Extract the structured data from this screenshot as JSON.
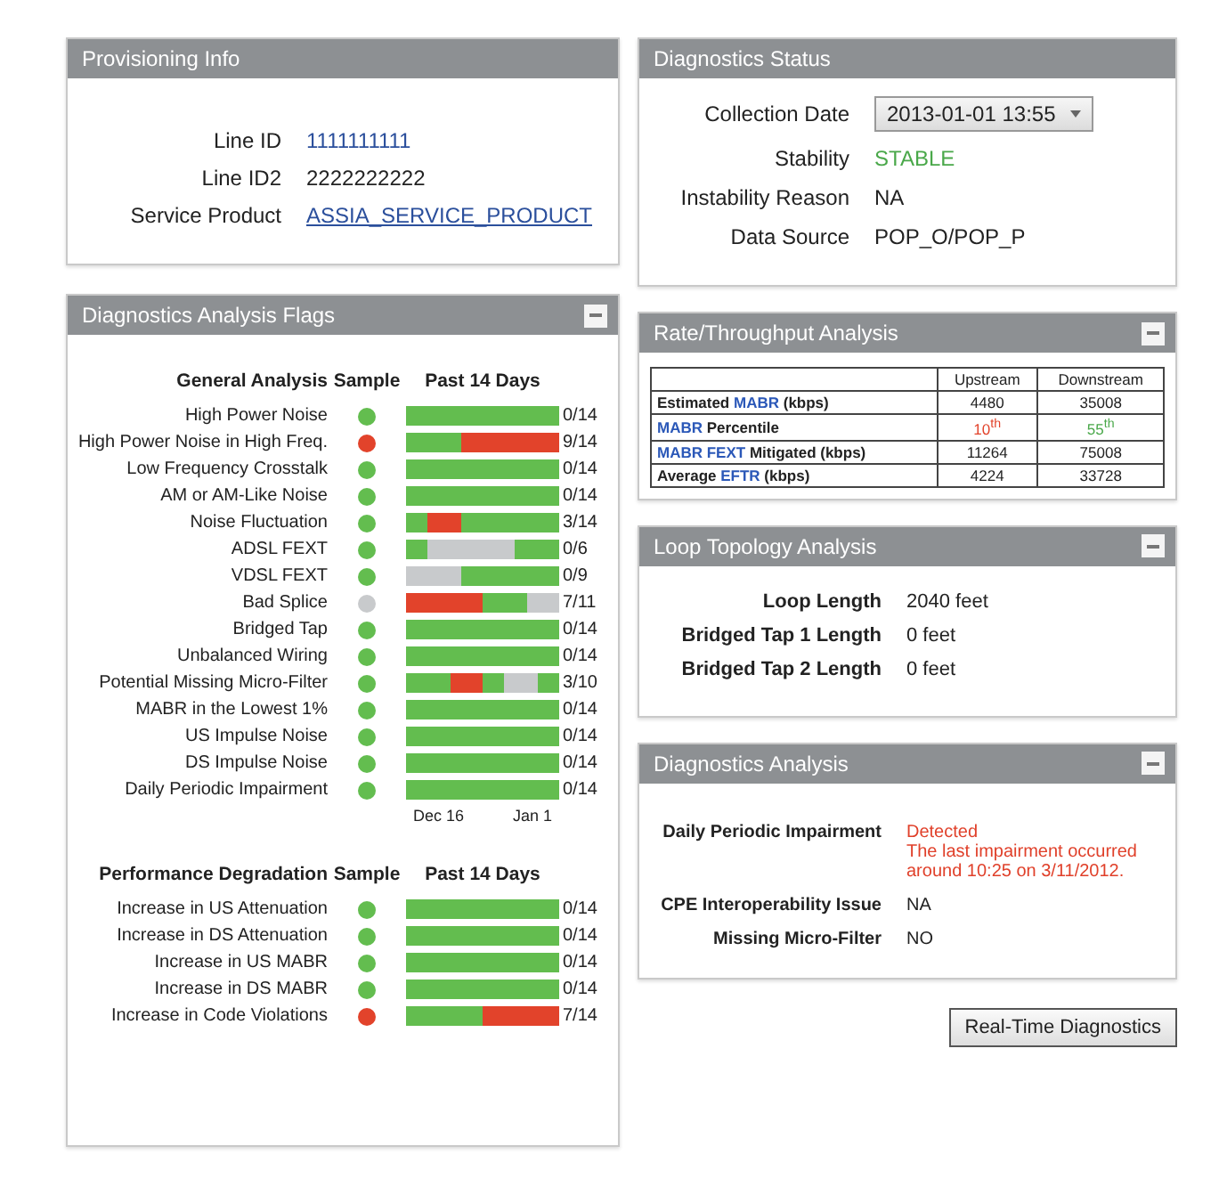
{
  "provisioning": {
    "title": "Provisioning Info",
    "fields": [
      {
        "label": "Line ID",
        "value": "1111111111",
        "kind": "id"
      },
      {
        "label": "Line ID2",
        "value": "2222222222",
        "kind": "text"
      },
      {
        "label": "Service Product",
        "value": "ASSIA_SERVICE_PRODUCT",
        "kind": "link"
      }
    ]
  },
  "diagnostics_status": {
    "title": "Diagnostics Status",
    "fields": [
      {
        "label": "Collection Date",
        "value": "2013-01-01 13:55",
        "kind": "dropdown"
      },
      {
        "label": "Stability",
        "value": "STABLE",
        "kind": "good"
      },
      {
        "label": "Instability Reason",
        "value": "NA",
        "kind": "text"
      },
      {
        "label": "Data Source",
        "value": "POP_O/POP_P",
        "kind": "text"
      }
    ]
  },
  "analysis_flags": {
    "title": "Diagnostics Analysis Flags",
    "collapsible": true,
    "sections": [
      {
        "heading": "General Analysis",
        "sample_heading": "Sample",
        "period_heading": "Past 14 Days",
        "axis_labels": [
          "Dec 16",
          "Jan 1"
        ],
        "rows": [
          {
            "name": "High Power Noise",
            "color": "#63bd4f",
            "days": [
              {
                "color": "#63bd4f"
              },
              {
                "color": "#63bd4f"
              },
              {
                "color": "#63bd4f"
              },
              {
                "color": "#63bd4f"
              },
              {
                "color": "#63bd4f"
              },
              {
                "color": "#63bd4f"
              },
              {
                "color": "#63bd4f"
              },
              {
                "color": "#63bd4f"
              },
              {
                "color": "#63bd4f"
              },
              {
                "color": "#63bd4f"
              },
              {
                "color": "#63bd4f"
              },
              {
                "color": "#63bd4f"
              },
              {
                "color": "#63bd4f"
              },
              {
                "color": "#63bd4f"
              }
            ],
            "count": "0/14"
          },
          {
            "name": "High Power Noise in High Freq.",
            "color": "#e2432b",
            "days": [
              {
                "color": "#63bd4f"
              },
              {
                "color": "#63bd4f"
              },
              {
                "color": "#63bd4f"
              },
              {
                "color": "#63bd4f"
              },
              {
                "color": "#63bd4f"
              },
              {
                "color": "#e2432b"
              },
              {
                "color": "#e2432b"
              },
              {
                "color": "#e2432b"
              },
              {
                "color": "#e2432b"
              },
              {
                "color": "#e2432b"
              },
              {
                "color": "#e2432b"
              },
              {
                "color": "#e2432b"
              },
              {
                "color": "#e2432b"
              },
              {
                "color": "#e2432b"
              }
            ],
            "count": "9/14"
          },
          {
            "name": "Low Frequency Crosstalk",
            "color": "#63bd4f",
            "days": [
              {
                "color": "#63bd4f"
              },
              {
                "color": "#63bd4f"
              },
              {
                "color": "#63bd4f"
              },
              {
                "color": "#63bd4f"
              },
              {
                "color": "#63bd4f"
              },
              {
                "color": "#63bd4f"
              },
              {
                "color": "#63bd4f"
              },
              {
                "color": "#63bd4f"
              },
              {
                "color": "#63bd4f"
              },
              {
                "color": "#63bd4f"
              },
              {
                "color": "#63bd4f"
              },
              {
                "color": "#63bd4f"
              },
              {
                "color": "#63bd4f"
              },
              {
                "color": "#63bd4f"
              }
            ],
            "count": "0/14"
          },
          {
            "name": "AM or AM-Like Noise",
            "color": "#63bd4f",
            "days": [
              {
                "color": "#63bd4f"
              },
              {
                "color": "#63bd4f"
              },
              {
                "color": "#63bd4f"
              },
              {
                "color": "#63bd4f"
              },
              {
                "color": "#63bd4f"
              },
              {
                "color": "#63bd4f"
              },
              {
                "color": "#63bd4f"
              },
              {
                "color": "#63bd4f"
              },
              {
                "color": "#63bd4f"
              },
              {
                "color": "#63bd4f"
              },
              {
                "color": "#63bd4f"
              },
              {
                "color": "#63bd4f"
              },
              {
                "color": "#63bd4f"
              },
              {
                "color": "#63bd4f"
              }
            ],
            "count": "0/14"
          },
          {
            "name": "Noise Fluctuation",
            "color": "#63bd4f",
            "days": [
              {
                "color": "#63bd4f"
              },
              {
                "color": "#63bd4f"
              },
              {
                "color": "#e2432b"
              },
              {
                "color": "#e2432b"
              },
              {
                "color": "#e2432b"
              },
              {
                "color": "#63bd4f"
              },
              {
                "color": "#63bd4f"
              },
              {
                "color": "#63bd4f"
              },
              {
                "color": "#63bd4f"
              },
              {
                "color": "#63bd4f"
              },
              {
                "color": "#63bd4f"
              },
              {
                "color": "#63bd4f"
              },
              {
                "color": "#63bd4f"
              },
              {
                "color": "#63bd4f"
              }
            ],
            "count": "3/14"
          },
          {
            "name": "ADSL FEXT",
            "color": "#63bd4f",
            "days": [
              {
                "color": "#63bd4f"
              },
              {
                "color": "#63bd4f"
              },
              {
                "color": "#c8cacc"
              },
              {
                "color": "#c8cacc"
              },
              {
                "color": "#c8cacc"
              },
              {
                "color": "#c8cacc"
              },
              {
                "color": "#c8cacc"
              },
              {
                "color": "#c8cacc"
              },
              {
                "color": "#c8cacc"
              },
              {
                "color": "#c8cacc"
              },
              {
                "color": "#63bd4f"
              },
              {
                "color": "#63bd4f"
              },
              {
                "color": "#63bd4f"
              },
              {
                "color": "#63bd4f"
              }
            ],
            "count": "0/6"
          },
          {
            "name": "VDSL FEXT",
            "color": "#63bd4f",
            "days": [
              {
                "color": "#c8cacc"
              },
              {
                "color": "#c8cacc"
              },
              {
                "color": "#c8cacc"
              },
              {
                "color": "#c8cacc"
              },
              {
                "color": "#c8cacc"
              },
              {
                "color": "#63bd4f"
              },
              {
                "color": "#63bd4f"
              },
              {
                "color": "#63bd4f"
              },
              {
                "color": "#63bd4f"
              },
              {
                "color": "#63bd4f"
              },
              {
                "color": "#63bd4f"
              },
              {
                "color": "#63bd4f"
              },
              {
                "color": "#63bd4f"
              },
              {
                "color": "#63bd4f"
              }
            ],
            "count": "0/9"
          },
          {
            "name": "Bad Splice",
            "color": "#c8cacc",
            "days": [
              {
                "color": "#e2432b"
              },
              {
                "color": "#e2432b"
              },
              {
                "color": "#e2432b"
              },
              {
                "color": "#e2432b"
              },
              {
                "color": "#e2432b"
              },
              {
                "color": "#e2432b"
              },
              {
                "color": "#e2432b"
              },
              {
                "color": "#63bd4f"
              },
              {
                "color": "#63bd4f"
              },
              {
                "color": "#63bd4f"
              },
              {
                "color": "#63bd4f"
              },
              {
                "color": "#c8cacc"
              },
              {
                "color": "#c8cacc"
              },
              {
                "color": "#c8cacc"
              }
            ],
            "count": "7/11"
          },
          {
            "name": "Bridged Tap",
            "color": "#63bd4f",
            "days": [
              {
                "color": "#63bd4f"
              },
              {
                "color": "#63bd4f"
              },
              {
                "color": "#63bd4f"
              },
              {
                "color": "#63bd4f"
              },
              {
                "color": "#63bd4f"
              },
              {
                "color": "#63bd4f"
              },
              {
                "color": "#63bd4f"
              },
              {
                "color": "#63bd4f"
              },
              {
                "color": "#63bd4f"
              },
              {
                "color": "#63bd4f"
              },
              {
                "color": "#63bd4f"
              },
              {
                "color": "#63bd4f"
              },
              {
                "color": "#63bd4f"
              },
              {
                "color": "#63bd4f"
              }
            ],
            "count": "0/14"
          },
          {
            "name": "Unbalanced Wiring",
            "color": "#63bd4f",
            "days": [
              {
                "color": "#63bd4f"
              },
              {
                "color": "#63bd4f"
              },
              {
                "color": "#63bd4f"
              },
              {
                "color": "#63bd4f"
              },
              {
                "color": "#63bd4f"
              },
              {
                "color": "#63bd4f"
              },
              {
                "color": "#63bd4f"
              },
              {
                "color": "#63bd4f"
              },
              {
                "color": "#63bd4f"
              },
              {
                "color": "#63bd4f"
              },
              {
                "color": "#63bd4f"
              },
              {
                "color": "#63bd4f"
              },
              {
                "color": "#63bd4f"
              },
              {
                "color": "#63bd4f"
              }
            ],
            "count": "0/14"
          },
          {
            "name": "Potential Missing Micro-Filter",
            "color": "#63bd4f",
            "days": [
              {
                "color": "#63bd4f"
              },
              {
                "color": "#63bd4f"
              },
              {
                "color": "#63bd4f"
              },
              {
                "color": "#63bd4f"
              },
              {
                "color": "#e2432b"
              },
              {
                "color": "#e2432b"
              },
              {
                "color": "#e2432b"
              },
              {
                "color": "#63bd4f"
              },
              {
                "color": "#63bd4f"
              },
              {
                "color": "#c8cacc"
              },
              {
                "color": "#c8cacc"
              },
              {
                "color": "#c8cacc"
              },
              {
                "color": "#63bd4f"
              },
              {
                "color": "#63bd4f"
              }
            ],
            "count": "3/10"
          },
          {
            "name": "MABR in the Lowest 1%",
            "color": "#63bd4f",
            "days": [
              {
                "color": "#63bd4f"
              },
              {
                "color": "#63bd4f"
              },
              {
                "color": "#63bd4f"
              },
              {
                "color": "#63bd4f"
              },
              {
                "color": "#63bd4f"
              },
              {
                "color": "#63bd4f"
              },
              {
                "color": "#63bd4f"
              },
              {
                "color": "#63bd4f"
              },
              {
                "color": "#63bd4f"
              },
              {
                "color": "#63bd4f"
              },
              {
                "color": "#63bd4f"
              },
              {
                "color": "#63bd4f"
              },
              {
                "color": "#63bd4f"
              },
              {
                "color": "#63bd4f"
              }
            ],
            "count": "0/14"
          },
          {
            "name": "US Impulse Noise",
            "color": "#63bd4f",
            "days": [
              {
                "color": "#63bd4f"
              },
              {
                "color": "#63bd4f"
              },
              {
                "color": "#63bd4f"
              },
              {
                "color": "#63bd4f"
              },
              {
                "color": "#63bd4f"
              },
              {
                "color": "#63bd4f"
              },
              {
                "color": "#63bd4f"
              },
              {
                "color": "#63bd4f"
              },
              {
                "color": "#63bd4f"
              },
              {
                "color": "#63bd4f"
              },
              {
                "color": "#63bd4f"
              },
              {
                "color": "#63bd4f"
              },
              {
                "color": "#63bd4f"
              },
              {
                "color": "#63bd4f"
              }
            ],
            "count": "0/14"
          },
          {
            "name": "DS Impulse Noise",
            "color": "#63bd4f",
            "days": [
              {
                "color": "#63bd4f"
              },
              {
                "color": "#63bd4f"
              },
              {
                "color": "#63bd4f"
              },
              {
                "color": "#63bd4f"
              },
              {
                "color": "#63bd4f"
              },
              {
                "color": "#63bd4f"
              },
              {
                "color": "#63bd4f"
              },
              {
                "color": "#63bd4f"
              },
              {
                "color": "#63bd4f"
              },
              {
                "color": "#63bd4f"
              },
              {
                "color": "#63bd4f"
              },
              {
                "color": "#63bd4f"
              },
              {
                "color": "#63bd4f"
              },
              {
                "color": "#63bd4f"
              }
            ],
            "count": "0/14"
          },
          {
            "name": "Daily Periodic Impairment",
            "color": "#63bd4f",
            "days": [
              {
                "color": "#63bd4f"
              },
              {
                "color": "#63bd4f"
              },
              {
                "color": "#63bd4f"
              },
              {
                "color": "#63bd4f"
              },
              {
                "color": "#63bd4f"
              },
              {
                "color": "#63bd4f"
              },
              {
                "color": "#63bd4f"
              },
              {
                "color": "#63bd4f"
              },
              {
                "color": "#63bd4f"
              },
              {
                "color": "#63bd4f"
              },
              {
                "color": "#63bd4f"
              },
              {
                "color": "#63bd4f"
              },
              {
                "color": "#63bd4f"
              },
              {
                "color": "#63bd4f"
              }
            ],
            "count": "0/14"
          }
        ]
      },
      {
        "heading": "Performance Degradation",
        "sample_heading": "Sample",
        "period_heading": "Past 14 Days",
        "rows": [
          {
            "name": "Increase in US Attenuation",
            "color": "#63bd4f",
            "days": [
              {
                "color": "#63bd4f"
              },
              {
                "color": "#63bd4f"
              },
              {
                "color": "#63bd4f"
              },
              {
                "color": "#63bd4f"
              },
              {
                "color": "#63bd4f"
              },
              {
                "color": "#63bd4f"
              },
              {
                "color": "#63bd4f"
              },
              {
                "color": "#63bd4f"
              },
              {
                "color": "#63bd4f"
              },
              {
                "color": "#63bd4f"
              },
              {
                "color": "#63bd4f"
              },
              {
                "color": "#63bd4f"
              },
              {
                "color": "#63bd4f"
              },
              {
                "color": "#63bd4f"
              }
            ],
            "count": "0/14"
          },
          {
            "name": "Increase in DS Attenuation",
            "color": "#63bd4f",
            "days": [
              {
                "color": "#63bd4f"
              },
              {
                "color": "#63bd4f"
              },
              {
                "color": "#63bd4f"
              },
              {
                "color": "#63bd4f"
              },
              {
                "color": "#63bd4f"
              },
              {
                "color": "#63bd4f"
              },
              {
                "color": "#63bd4f"
              },
              {
                "color": "#63bd4f"
              },
              {
                "color": "#63bd4f"
              },
              {
                "color": "#63bd4f"
              },
              {
                "color": "#63bd4f"
              },
              {
                "color": "#63bd4f"
              },
              {
                "color": "#63bd4f"
              },
              {
                "color": "#63bd4f"
              }
            ],
            "count": "0/14"
          },
          {
            "name": "Increase in US MABR",
            "color": "#63bd4f",
            "days": [
              {
                "color": "#63bd4f"
              },
              {
                "color": "#63bd4f"
              },
              {
                "color": "#63bd4f"
              },
              {
                "color": "#63bd4f"
              },
              {
                "color": "#63bd4f"
              },
              {
                "color": "#63bd4f"
              },
              {
                "color": "#63bd4f"
              },
              {
                "color": "#63bd4f"
              },
              {
                "color": "#63bd4f"
              },
              {
                "color": "#63bd4f"
              },
              {
                "color": "#63bd4f"
              },
              {
                "color": "#63bd4f"
              },
              {
                "color": "#63bd4f"
              },
              {
                "color": "#63bd4f"
              }
            ],
            "count": "0/14"
          },
          {
            "name": "Increase in DS MABR",
            "color": "#63bd4f",
            "days": [
              {
                "color": "#63bd4f"
              },
              {
                "color": "#63bd4f"
              },
              {
                "color": "#63bd4f"
              },
              {
                "color": "#63bd4f"
              },
              {
                "color": "#63bd4f"
              },
              {
                "color": "#63bd4f"
              },
              {
                "color": "#63bd4f"
              },
              {
                "color": "#63bd4f"
              },
              {
                "color": "#63bd4f"
              },
              {
                "color": "#63bd4f"
              },
              {
                "color": "#63bd4f"
              },
              {
                "color": "#63bd4f"
              },
              {
                "color": "#63bd4f"
              },
              {
                "color": "#63bd4f"
              }
            ],
            "count": "0/14"
          },
          {
            "name": "Increase in Code Violations",
            "color": "#e2432b",
            "days": [
              {
                "color": "#63bd4f"
              },
              {
                "color": "#63bd4f"
              },
              {
                "color": "#63bd4f"
              },
              {
                "color": "#63bd4f"
              },
              {
                "color": "#63bd4f"
              },
              {
                "color": "#63bd4f"
              },
              {
                "color": "#63bd4f"
              },
              {
                "color": "#e2432b"
              },
              {
                "color": "#e2432b"
              },
              {
                "color": "#e2432b"
              },
              {
                "color": "#e2432b"
              },
              {
                "color": "#e2432b"
              },
              {
                "color": "#e2432b"
              },
              {
                "color": "#e2432b"
              }
            ],
            "count": "7/14"
          }
        ]
      }
    ]
  },
  "rate_throughput": {
    "title": "Rate/Throughput Analysis",
    "collapsible": true,
    "columns": [
      "Upstream",
      "Downstream"
    ],
    "rows": [
      {
        "label": [
          {
            "text": "Estimated ",
            "link": false
          },
          {
            "text": "MABR",
            "link": true
          },
          {
            "text": " (kbps)",
            "link": false
          }
        ],
        "cells": [
          {
            "value": "4480"
          },
          {
            "value": "35008"
          }
        ]
      },
      {
        "label": [
          {
            "text": "MABR",
            "link": true
          },
          {
            "text": " Percentile",
            "link": false
          }
        ],
        "cells": [
          {
            "value": "10$^{th}$",
            "color": "#e2432b"
          },
          {
            "value": "55$^{th}$",
            "color": "#4aa84a"
          }
        ]
      },
      {
        "label": [
          {
            "text": "MABR FEXT",
            "link": true
          },
          {
            "text": " Mitigated (kbps)",
            "link": false
          }
        ],
        "cells": [
          {
            "value": "11264"
          },
          {
            "value": "75008"
          }
        ]
      },
      {
        "label": [
          {
            "text": "Average ",
            "link": false
          },
          {
            "text": "EFTR",
            "link": true
          },
          {
            "text": " (kbps)",
            "link": false
          }
        ],
        "cells": [
          {
            "value": "4224"
          },
          {
            "value": "33728"
          }
        ]
      }
    ]
  },
  "loop_topology": {
    "title": "Loop Topology Analysis",
    "collapsible": true,
    "fields": [
      {
        "label": "Loop Length",
        "value": "2040 feet"
      },
      {
        "label": "Bridged Tap 1 Length",
        "value": "0 feet"
      },
      {
        "label": "Bridged Tap 2 Length",
        "value": "0 feet"
      }
    ]
  },
  "diagnostics_analysis": {
    "title": "Diagnostics Analysis",
    "collapsible": true,
    "fields": [
      {
        "label": "Daily Periodic Impairment",
        "lines": [
          "Detected",
          "The last impairment occurred",
          "around 10:25 on 3/11/2012."
        ],
        "color": "#e0402a"
      },
      {
        "label": "CPE Interoperability Issue",
        "lines": [
          "NA"
        ]
      },
      {
        "label": "Missing Micro-Filter",
        "lines": [
          "NO"
        ]
      }
    ]
  },
  "actions": [
    {
      "label": "Real-Time Diagnostics"
    }
  ]
}
